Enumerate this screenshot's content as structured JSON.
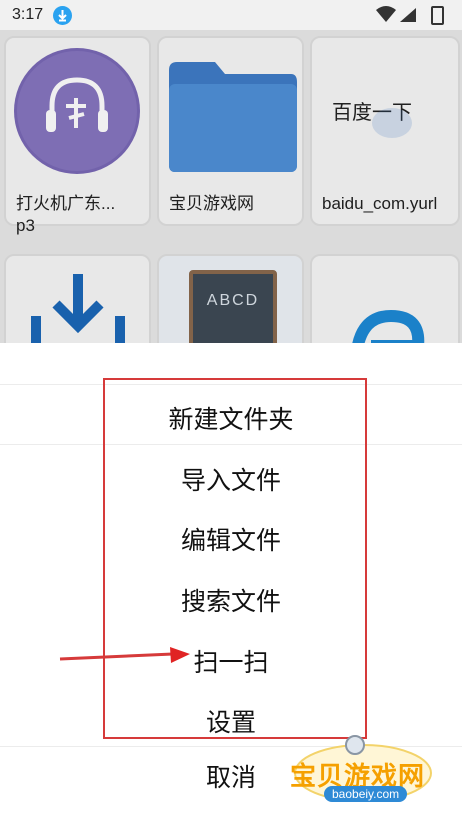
{
  "status_bar": {
    "time": "3:17"
  },
  "files": [
    {
      "caption": "打火机广东...\np3",
      "icon": "music-file-icon"
    },
    {
      "caption": "宝贝游戏网",
      "icon": "folder-icon"
    },
    {
      "caption": "baidu_com.yurl",
      "icon": "link-file-icon",
      "preview_text": "百度一下"
    },
    {
      "caption": "",
      "icon": "download-icon"
    },
    {
      "caption": "",
      "icon": "book-board-icon",
      "preview_text": "ABCD"
    },
    {
      "caption": "",
      "icon": "browser-icon"
    }
  ],
  "menu": {
    "items": [
      "新建文件夹",
      "导入文件",
      "编辑文件",
      "搜索文件",
      "扫一扫",
      "设置"
    ],
    "cancel": "取消"
  },
  "watermark": {
    "title": "宝贝游戏网",
    "url": "baobeiy.com"
  },
  "colors": {
    "annotation": "#d63a3a",
    "accent": "#2aa2f0"
  }
}
